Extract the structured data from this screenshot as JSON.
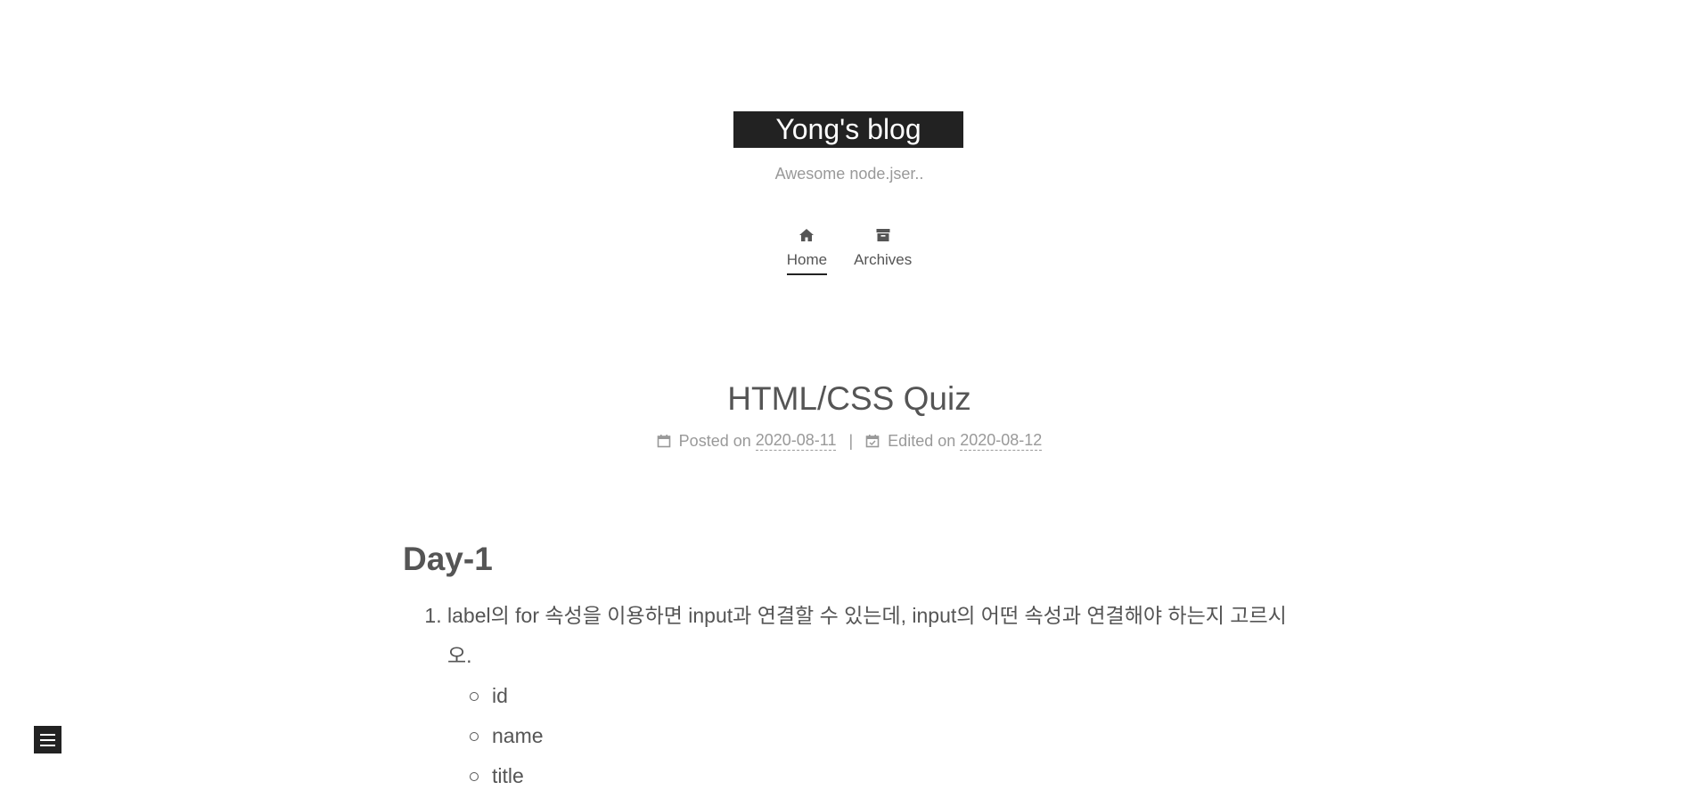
{
  "site": {
    "title": "Yong's blog",
    "subtitle": "Awesome node.jser.."
  },
  "menu": {
    "items": [
      {
        "label": "Home",
        "icon": "home-icon",
        "active": true
      },
      {
        "label": "Archives",
        "icon": "archive-icon",
        "active": false
      }
    ]
  },
  "post": {
    "title": "HTML/CSS Quiz",
    "posted_label": "Posted on",
    "posted_date": "2020-08-11",
    "divider": "|",
    "edited_label": "Edited on",
    "edited_date": "2020-08-12"
  },
  "content": {
    "heading": "Day-1",
    "questions": [
      {
        "text": "label의 for 속성을 이용하면 input과 연결할 수 있는데, input의 어떤 속성과 연결해야 하는지 고르시오.",
        "options": [
          "id",
          "name",
          "title"
        ]
      }
    ]
  },
  "colors": {
    "brand_bg": "#222222",
    "text": "#555555",
    "muted": "#999999"
  }
}
